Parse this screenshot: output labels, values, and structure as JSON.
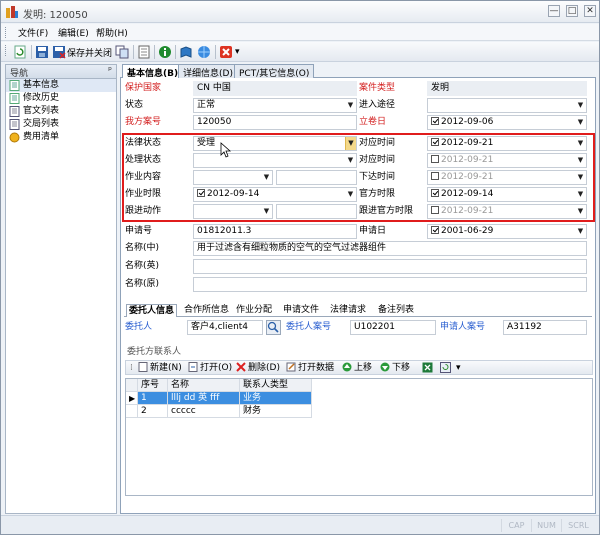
{
  "window": {
    "title": "发明: 120050",
    "buttons": {
      "minimize": "—",
      "maximize": "□",
      "close": "✕"
    }
  },
  "menu": [
    "文件(F)",
    "编辑(E)",
    "帮助(H)"
  ],
  "toolbar": {
    "save_close_label": "保存并关闭"
  },
  "nav": {
    "title": "导航",
    "pin": "ᵖ",
    "items": [
      "基本信息",
      "修改历史",
      "官文列表",
      "交局列表",
      "费用清单"
    ]
  },
  "tabs": [
    "基本信息(B)",
    "详细信息(D)",
    "PCT/其它信息(O)"
  ],
  "form": {
    "country_label": "保护国家",
    "country_value": "CN 中国",
    "case_type_label": "案件类型",
    "case_type_value": "发明",
    "status_label": "状态",
    "status_value": "正常",
    "entry_label": "进入途径",
    "entry_value": "",
    "our_ref_label": "我方案号",
    "our_ref_value": "120050",
    "filing_date_label": "立卷日",
    "filing_date_value": "2012-09-06",
    "legal_status_label": "法律状态",
    "legal_status_value": "受理",
    "legal_time_label": "对应时间",
    "legal_time_value": "2012-09-21",
    "proc_status_label": "处理状态",
    "proc_status_value": "",
    "proc_time_label": "对应时间",
    "proc_time_value": "2012-09-21",
    "work_content_label": "作业内容",
    "work_content_value": "",
    "issue_time_label": "下达时间",
    "issue_time_value": "2012-09-21",
    "work_deadline_label": "作业时限",
    "work_deadline_value": "2012-09-14",
    "official_deadline_label": "官方时限",
    "official_deadline_value": "2012-09-14",
    "follow_label": "跟进动作",
    "follow_value": "",
    "follow_official_label": "跟进官方时限",
    "follow_official_value": "2012-09-21",
    "app_no_label": "申请号",
    "app_no_value": "01812011.3",
    "app_date_label": "申请日",
    "app_date_value": "2001-06-29",
    "name_cn_label": "名称(中)",
    "name_cn_value": "用于过滤含有细粒物质的空气的空气过滤器组件",
    "name_en_label": "名称(英)",
    "name_en_value": "",
    "name_orig_label": "名称(原)",
    "name_orig_value": ""
  },
  "subtabs": [
    "委托人信息",
    "合作所信息",
    "作业分配",
    "申请文件",
    "法律请求",
    "备注列表"
  ],
  "client": {
    "client_label": "委托人",
    "client_value": "客户4,client4",
    "client_ref_label": "委托人案号",
    "client_ref_value": "U102201",
    "applicant_ref_label": "申请人案号",
    "applicant_ref_value": "A31192"
  },
  "contacts": {
    "section_title": "委托方联系人",
    "toolbar": [
      "新建(N)",
      "打开(O)",
      "删除(D)",
      "打开数据",
      "上移",
      "下移"
    ],
    "columns": [
      "序号",
      "名称",
      "联系人类型"
    ],
    "rows": [
      {
        "no": "1",
        "name": "lllj dd 英 fff",
        "type": "业务"
      },
      {
        "no": "2",
        "name": "ccccc",
        "type": "财务"
      }
    ]
  },
  "statusbar": [
    "CAP",
    "NUM",
    "SCRL"
  ]
}
